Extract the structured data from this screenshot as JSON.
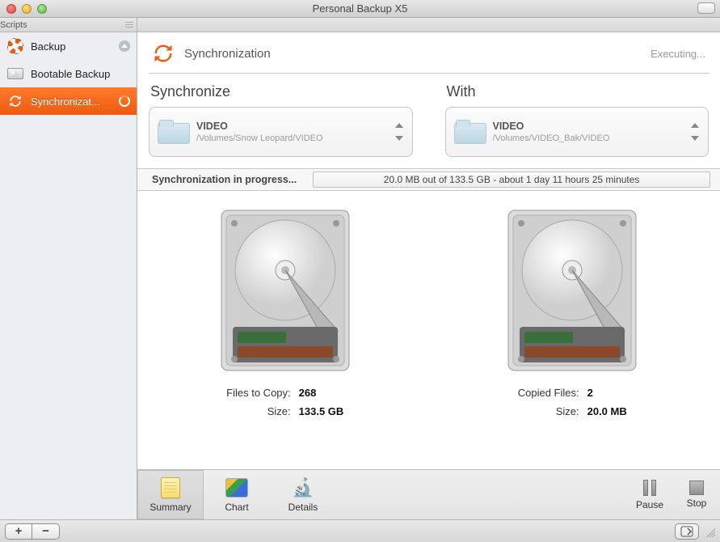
{
  "window": {
    "title": "Personal Backup X5"
  },
  "sidebar": {
    "header": "Scripts",
    "items": [
      {
        "label": "Backup"
      },
      {
        "label": "Bootable Backup"
      },
      {
        "label": "Synchronizat..."
      }
    ]
  },
  "header": {
    "title": "Synchronization",
    "status": "Executing..."
  },
  "columns": {
    "left_title": "Synchronize",
    "right_title": "With"
  },
  "source": {
    "name": "VIDEO",
    "path": "/Volumes/Snow Leopard/VIDEO"
  },
  "dest": {
    "name": "VIDEO",
    "path": "/Volumes/VIDEO_Bak/VIDEO"
  },
  "progress": {
    "label": "Synchronization in progress...",
    "detail": "20.0 MB out of 133.5 GB - about 1 day 11 hours 25 minutes"
  },
  "source_stats": {
    "files_to_copy_label": "Files to Copy:",
    "files_to_copy_value": "268",
    "size_label": "Size:",
    "size_value": "133.5 GB"
  },
  "dest_stats": {
    "copied_files_label": "Copied Files:",
    "copied_files_value": "2",
    "size_label": "Size:",
    "size_value": "20.0 MB"
  },
  "tabs": {
    "summary": "Summary",
    "chart": "Chart",
    "details": "Details"
  },
  "controls": {
    "pause": "Pause",
    "stop": "Stop"
  },
  "bottom": {
    "add": "+",
    "remove": "−"
  }
}
